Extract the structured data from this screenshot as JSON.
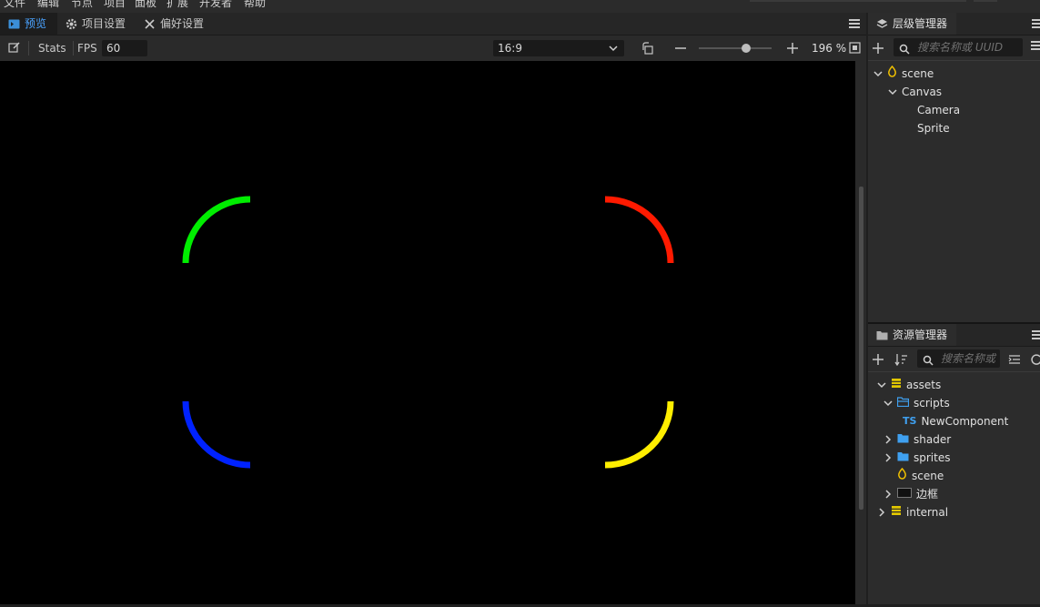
{
  "menu": [
    "文件",
    "编辑",
    "节点",
    "项目",
    "面板",
    "扩展",
    "开发者",
    "帮助"
  ],
  "left_tabs": [
    {
      "label": "预览",
      "icon": "preview-icon",
      "active": true
    },
    {
      "label": "项目设置",
      "icon": "gear-icon",
      "active": false
    },
    {
      "label": "偏好设置",
      "icon": "tools-icon",
      "active": false
    }
  ],
  "toolbar": {
    "stats_label": "Stats",
    "fps_label": "FPS",
    "fps_value": "60",
    "ratio_value": "16:9",
    "zoom_value": "196 %",
    "zoom_slider_level": 0.65
  },
  "hierarchy": {
    "title": "层级管理器",
    "search_placeholder": "搜索名称或 UUID",
    "nodes": [
      {
        "label": "scene",
        "expanded": true
      },
      {
        "label": "Canvas",
        "expanded": true
      },
      {
        "label": "Camera"
      },
      {
        "label": "Sprite"
      }
    ]
  },
  "assets": {
    "title": "资源管理器",
    "search_placeholder": "搜索名称或",
    "nodes": [
      {
        "label": "assets"
      },
      {
        "label": "scripts"
      },
      {
        "label": "NewComponent",
        "badge": "TS"
      },
      {
        "label": "shader"
      },
      {
        "label": "sprites"
      },
      {
        "label": "scene"
      },
      {
        "label": "边框"
      },
      {
        "label": "internal"
      }
    ]
  },
  "colors": {
    "accent": "#4aa3ff",
    "border_gradient": [
      "#00ff00",
      "#ff2200",
      "#ffee00",
      "#0022ff"
    ]
  }
}
